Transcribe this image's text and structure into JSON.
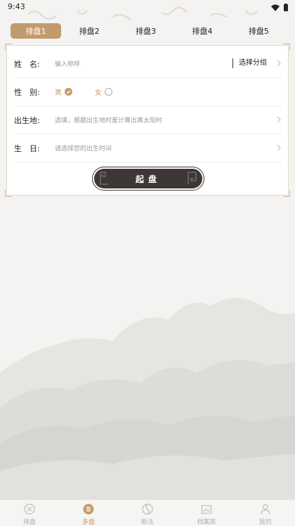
{
  "status": {
    "time": "9:43"
  },
  "tabs": [
    {
      "label": "排盘1",
      "active": true
    },
    {
      "label": "排盘2",
      "active": false
    },
    {
      "label": "排盘3",
      "active": false
    },
    {
      "label": "排盘4",
      "active": false
    },
    {
      "label": "排盘5",
      "active": false
    }
  ],
  "form": {
    "name_label": "姓　名:",
    "name_placeholder": "输入称呼",
    "group_select": "选择分组",
    "gender_label": "性　别:",
    "gender_male": "男",
    "gender_female": "女",
    "gender_selected": "男",
    "birthplace_label": "出生地:",
    "birthplace_placeholder": "选填，根据出生地时差计算出真太阳时",
    "birthday_label": "生　日:",
    "birthday_placeholder": "请选择您的出生时间",
    "start_button": "起盘"
  },
  "bottom_nav": [
    {
      "label": "排盘",
      "icon": "paipan-icon",
      "active": false
    },
    {
      "label": "多盘",
      "icon": "duopan-icon",
      "active": true
    },
    {
      "label": "断法",
      "icon": "duanfa-icon",
      "active": false
    },
    {
      "label": "档案库",
      "icon": "archive-icon",
      "active": false
    },
    {
      "label": "我的",
      "icon": "profile-icon",
      "active": false
    }
  ],
  "colors": {
    "accent": "#c29b6d",
    "button_dark": "#3d3836"
  }
}
